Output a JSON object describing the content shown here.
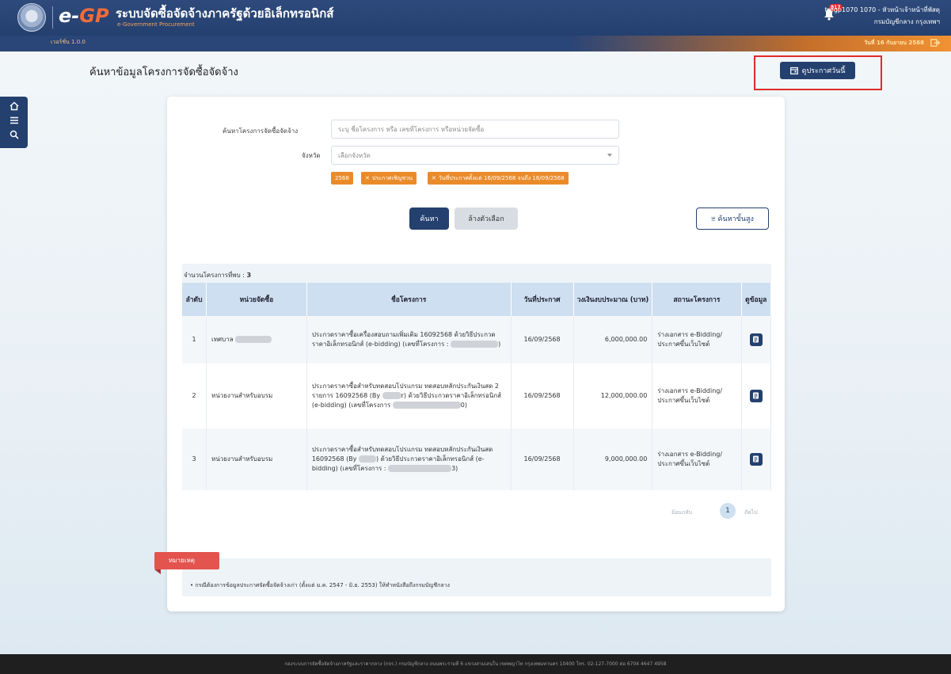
{
  "header": {
    "logo_e": "e",
    "logo_dash": "-",
    "logo_gp": "GP",
    "title": "ระบบจัดซื้อจัดจ้างภาครัฐด้วยอิเล็กทรอนิกส์",
    "subtitle": "e-Government Procurement",
    "notification_count": "817",
    "user_name": "tregp1070 1070 - หัวหน้าเจ้าหน้าที่พัสดุ",
    "user_dept": "กรมบัญชีกลาง กรุงเทพฯ"
  },
  "version_bar": {
    "version": "เวอร์ชั่น 1.0.0",
    "date_now": "วันที่ 16 กันยายน 2568"
  },
  "page": {
    "title": "ค้นหาข้อมูลโครงการจัดซื้อจัดจ้าง",
    "today_button": "ดูประกาศวันนี้"
  },
  "search": {
    "keyword_label": "ค้นหาโครงการจัดซื้อจัดจ้าง",
    "keyword_placeholder": "ระบุ ชื่อโครงการ หรือ เลขที่โครงการ หรือหน่วยจัดซื้อ",
    "province_label": "จังหวัด",
    "province_value": "เลือกจังหวัด",
    "chips": [
      "2568",
      "ประกาศเชิญชวน",
      "วันที่ประกาศตั้งแต่ 16/09/2568 จนถึง 16/09/2568"
    ],
    "search_button": "ค้นหา",
    "clear_button": "ล้างตัวเลือก",
    "advanced_button": "ค้นหาขั้นสูง"
  },
  "results": {
    "count_label": "จำนวนโครงการที่พบ :",
    "count": "3",
    "columns": [
      "ลำดับ",
      "หน่วยจัดซื้อ",
      "ชื่อโครงการ",
      "วันที่ประกาศ",
      "วงเงินงบประมาณ (บาท)",
      "สถานะโครงการ",
      "ดูข้อมูล"
    ],
    "rows": [
      {
        "no": "1",
        "agency": "เทศบาล",
        "name_a": "ประกวดราคาซื้อเครื่องสอบถามเพิ่มเติม",
        "name_b": "16092568 ด้วยวิธีประกวดราคาอิเล็กทรอนิกส์ (e-bidding) (เลขที่โครงการ :",
        "name_c": ")",
        "date": "16/09/2568",
        "budget": "6,000,000.00",
        "status": "ร่างเอกสาร e-Bidding/ประกาศขึ้นเว็บไซต์"
      },
      {
        "no": "2",
        "agency": "หน่วยงานสำหรับอบรม",
        "name_a": "ประกวดราคาซื้อสำหรับทดสอบโปรแกรม ทดสอบหลักประกันเงินสด 2 รายการ 16092568 (By",
        "name_b": "r) ด้วยวิธีประกวดราคาอิเล็กทรอนิกส์ (e-bidding) (เลขที่โครงการ",
        "name_c": "0)",
        "date": "16/09/2568",
        "budget": "12,000,000.00",
        "status": "ร่างเอกสาร e-Bidding/ประกาศขึ้นเว็บไซต์"
      },
      {
        "no": "3",
        "agency": "หน่วยงานสำหรับอบรม",
        "name_a": "ประกวดราคาซื้อสำหรับทดสอบโปรแกรม ทดสอบหลักประกันเงินสด 16092568 (By",
        "name_b": ") ด้วยวิธีประกวดราคาอิเล็กทรอนิกส์ (e-bidding) (เลขที่โครงการ :",
        "name_c": "3)",
        "date": "16/09/2568",
        "budget": "9,000,000.00",
        "status": "ร่างเอกสาร e-Bidding/ประกาศขึ้นเว็บไซต์"
      }
    ]
  },
  "pagination": {
    "prev": "ย้อนกลับ",
    "page": "1",
    "next": "ถัดไป"
  },
  "note": {
    "tag": "หมายเหตุ",
    "text": "• กรณีต้องการข้อมูลประกาศจัดซื้อจัดจ้างเก่า (ตั้งแต่ ม.ค. 2547 - มิ.ย. 2553) ให้ทำหนังสือถึงกรมบัญชีกลาง"
  },
  "footer": {
    "text": "กองระบบการจัดซื้อจัดจ้างภาครัฐและราคากลาง (กจร.) กรมบัญชีกลาง ถนนพระรามที่ 6 แขวงสามเสนใน เขตพญาไท กรุงเทพมหานคร 10400 โทร. 02-127-7000 ต่อ 6704 4647 4958"
  },
  "colors": {
    "navy": "#24406f",
    "orange": "#ea8b2a",
    "highlight": "#e02a2a",
    "note_tag": "#e3544f"
  },
  "icons": [
    "home-icon",
    "menu-icon",
    "search-icon",
    "bell-icon",
    "calendar-icon",
    "logout-icon",
    "advanced-search-icon",
    "document-icon",
    "close-icon",
    "chevron-down-icon"
  ]
}
